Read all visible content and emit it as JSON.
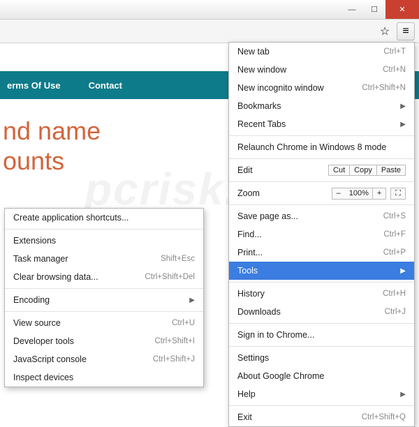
{
  "titlebar": {
    "min": "—",
    "max": "☐",
    "close": "✕"
  },
  "toolbar": {
    "star": "☆",
    "menu": "≡"
  },
  "page_nav": {
    "terms": "erms Of Use",
    "contact": "Contact"
  },
  "hero": {
    "line1": "nd name",
    "line2": "ounts"
  },
  "main_menu": {
    "new_tab": "New tab",
    "new_tab_sc": "Ctrl+T",
    "new_window": "New window",
    "new_window_sc": "Ctrl+N",
    "new_incognito": "New incognito window",
    "new_incognito_sc": "Ctrl+Shift+N",
    "bookmarks": "Bookmarks",
    "recent_tabs": "Recent Tabs",
    "relaunch": "Relaunch Chrome in Windows 8 mode",
    "edit": "Edit",
    "cut": "Cut",
    "copy": "Copy",
    "paste": "Paste",
    "zoom": "Zoom",
    "zoom_minus": "–",
    "zoom_val": "100%",
    "zoom_plus": "+",
    "zoom_full": "⛶",
    "save_page": "Save page as...",
    "save_page_sc": "Ctrl+S",
    "find": "Find...",
    "find_sc": "Ctrl+F",
    "print": "Print...",
    "print_sc": "Ctrl+P",
    "tools": "Tools",
    "history": "History",
    "history_sc": "Ctrl+H",
    "downloads": "Downloads",
    "downloads_sc": "Ctrl+J",
    "signin": "Sign in to Chrome...",
    "settings": "Settings",
    "about": "About Google Chrome",
    "help": "Help",
    "exit": "Exit",
    "exit_sc": "Ctrl+Shift+Q"
  },
  "sub_menu": {
    "create_shortcuts": "Create application shortcuts...",
    "extensions": "Extensions",
    "task_manager": "Task manager",
    "task_manager_sc": "Shift+Esc",
    "clear_data": "Clear browsing data...",
    "clear_data_sc": "Ctrl+Shift+Del",
    "encoding": "Encoding",
    "view_source": "View source",
    "view_source_sc": "Ctrl+U",
    "dev_tools": "Developer tools",
    "dev_tools_sc": "Ctrl+Shift+I",
    "js_console": "JavaScript console",
    "js_console_sc": "Ctrl+Shift+J",
    "inspect": "Inspect devices"
  },
  "watermark": "pcrisk.com"
}
